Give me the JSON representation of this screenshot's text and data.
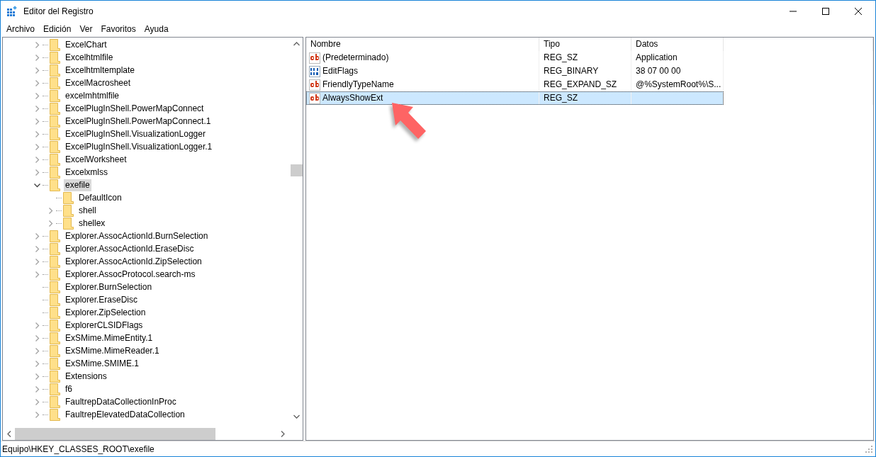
{
  "window": {
    "title": "Editor del Registro"
  },
  "menu": [
    "Archivo",
    "Edición",
    "Ver",
    "Favoritos",
    "Ayuda"
  ],
  "tree": [
    {
      "label": "ExcelChart",
      "has_children": true,
      "expanded": false,
      "selected": false
    },
    {
      "label": "Excelhtmlfile",
      "has_children": true,
      "expanded": false,
      "selected": false
    },
    {
      "label": "Excelhtmltemplate",
      "has_children": true,
      "expanded": false,
      "selected": false
    },
    {
      "label": "ExcelMacrosheet",
      "has_children": true,
      "expanded": false,
      "selected": false
    },
    {
      "label": "excelmhtmlfile",
      "has_children": true,
      "expanded": false,
      "selected": false
    },
    {
      "label": "ExcelPlugInShell.PowerMapConnect",
      "has_children": true,
      "expanded": false,
      "selected": false
    },
    {
      "label": "ExcelPlugInShell.PowerMapConnect.1",
      "has_children": true,
      "expanded": false,
      "selected": false
    },
    {
      "label": "ExcelPlugInShell.VisualizationLogger",
      "has_children": true,
      "expanded": false,
      "selected": false
    },
    {
      "label": "ExcelPlugInShell.VisualizationLogger.1",
      "has_children": true,
      "expanded": false,
      "selected": false
    },
    {
      "label": "ExcelWorksheet",
      "has_children": true,
      "expanded": false,
      "selected": false
    },
    {
      "label": "Excelxmlss",
      "has_children": true,
      "expanded": false,
      "selected": false
    },
    {
      "label": "exefile",
      "has_children": true,
      "expanded": true,
      "selected": true,
      "children": [
        {
          "label": "DefaultIcon",
          "has_children": false,
          "selected": false
        },
        {
          "label": "shell",
          "has_children": true,
          "expanded": false,
          "selected": false
        },
        {
          "label": "shellex",
          "has_children": true,
          "expanded": false,
          "selected": false
        }
      ]
    },
    {
      "label": "Explorer.AssocActionId.BurnSelection",
      "has_children": true,
      "expanded": false,
      "selected": false
    },
    {
      "label": "Explorer.AssocActionId.EraseDisc",
      "has_children": true,
      "expanded": false,
      "selected": false
    },
    {
      "label": "Explorer.AssocActionId.ZipSelection",
      "has_children": true,
      "expanded": false,
      "selected": false
    },
    {
      "label": "Explorer.AssocProtocol.search-ms",
      "has_children": true,
      "expanded": false,
      "selected": false
    },
    {
      "label": "Explorer.BurnSelection",
      "has_children": false,
      "selected": false
    },
    {
      "label": "Explorer.EraseDisc",
      "has_children": false,
      "selected": false
    },
    {
      "label": "Explorer.ZipSelection",
      "has_children": false,
      "selected": false
    },
    {
      "label": "ExplorerCLSIDFlags",
      "has_children": true,
      "expanded": false,
      "selected": false
    },
    {
      "label": "ExSMime.MimeEntity.1",
      "has_children": true,
      "expanded": false,
      "selected": false
    },
    {
      "label": "ExSMime.MimeReader.1",
      "has_children": true,
      "expanded": false,
      "selected": false
    },
    {
      "label": "ExSMime.SMIME.1",
      "has_children": true,
      "expanded": false,
      "selected": false
    },
    {
      "label": "Extensions",
      "has_children": true,
      "expanded": false,
      "selected": false
    },
    {
      "label": "f6",
      "has_children": true,
      "expanded": false,
      "selected": false
    },
    {
      "label": "FaultrepDataCollectionInProc",
      "has_children": true,
      "expanded": false,
      "selected": false
    },
    {
      "label": "FaultrepElevatedDataCollection",
      "has_children": true,
      "expanded": false,
      "selected": false
    }
  ],
  "values": {
    "columns": [
      "Nombre",
      "Tipo",
      "Datos"
    ],
    "rows": [
      {
        "kind": "string",
        "name": "(Predeterminado)",
        "type": "REG_SZ",
        "data": "Application",
        "selected": false
      },
      {
        "kind": "binary",
        "name": "EditFlags",
        "type": "REG_BINARY",
        "data": "38 07 00 00",
        "selected": false
      },
      {
        "kind": "string",
        "name": "FriendlyTypeName",
        "type": "REG_EXPAND_SZ",
        "data": "@%SystemRoot%\\S...",
        "selected": false
      },
      {
        "kind": "string",
        "name": "AlwaysShowExt",
        "type": "REG_SZ",
        "selected": true
      }
    ]
  },
  "status_bar": "Equipo\\HKEY_CLASSES_ROOT\\exefile"
}
